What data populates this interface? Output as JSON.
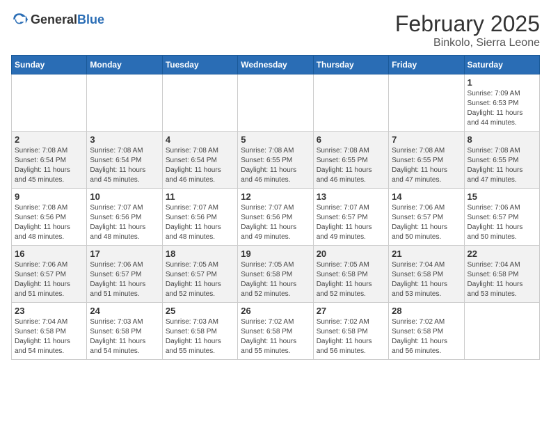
{
  "header": {
    "logo_general": "General",
    "logo_blue": "Blue",
    "month": "February 2025",
    "location": "Binkolo, Sierra Leone"
  },
  "days_of_week": [
    "Sunday",
    "Monday",
    "Tuesday",
    "Wednesday",
    "Thursday",
    "Friday",
    "Saturday"
  ],
  "weeks": [
    [
      {
        "day": "",
        "info": ""
      },
      {
        "day": "",
        "info": ""
      },
      {
        "day": "",
        "info": ""
      },
      {
        "day": "",
        "info": ""
      },
      {
        "day": "",
        "info": ""
      },
      {
        "day": "",
        "info": ""
      },
      {
        "day": "1",
        "info": "Sunrise: 7:09 AM\nSunset: 6:53 PM\nDaylight: 11 hours\nand 44 minutes."
      }
    ],
    [
      {
        "day": "2",
        "info": "Sunrise: 7:08 AM\nSunset: 6:54 PM\nDaylight: 11 hours\nand 45 minutes."
      },
      {
        "day": "3",
        "info": "Sunrise: 7:08 AM\nSunset: 6:54 PM\nDaylight: 11 hours\nand 45 minutes."
      },
      {
        "day": "4",
        "info": "Sunrise: 7:08 AM\nSunset: 6:54 PM\nDaylight: 11 hours\nand 46 minutes."
      },
      {
        "day": "5",
        "info": "Sunrise: 7:08 AM\nSunset: 6:55 PM\nDaylight: 11 hours\nand 46 minutes."
      },
      {
        "day": "6",
        "info": "Sunrise: 7:08 AM\nSunset: 6:55 PM\nDaylight: 11 hours\nand 46 minutes."
      },
      {
        "day": "7",
        "info": "Sunrise: 7:08 AM\nSunset: 6:55 PM\nDaylight: 11 hours\nand 47 minutes."
      },
      {
        "day": "8",
        "info": "Sunrise: 7:08 AM\nSunset: 6:55 PM\nDaylight: 11 hours\nand 47 minutes."
      }
    ],
    [
      {
        "day": "9",
        "info": "Sunrise: 7:08 AM\nSunset: 6:56 PM\nDaylight: 11 hours\nand 48 minutes."
      },
      {
        "day": "10",
        "info": "Sunrise: 7:07 AM\nSunset: 6:56 PM\nDaylight: 11 hours\nand 48 minutes."
      },
      {
        "day": "11",
        "info": "Sunrise: 7:07 AM\nSunset: 6:56 PM\nDaylight: 11 hours\nand 48 minutes."
      },
      {
        "day": "12",
        "info": "Sunrise: 7:07 AM\nSunset: 6:56 PM\nDaylight: 11 hours\nand 49 minutes."
      },
      {
        "day": "13",
        "info": "Sunrise: 7:07 AM\nSunset: 6:57 PM\nDaylight: 11 hours\nand 49 minutes."
      },
      {
        "day": "14",
        "info": "Sunrise: 7:06 AM\nSunset: 6:57 PM\nDaylight: 11 hours\nand 50 minutes."
      },
      {
        "day": "15",
        "info": "Sunrise: 7:06 AM\nSunset: 6:57 PM\nDaylight: 11 hours\nand 50 minutes."
      }
    ],
    [
      {
        "day": "16",
        "info": "Sunrise: 7:06 AM\nSunset: 6:57 PM\nDaylight: 11 hours\nand 51 minutes."
      },
      {
        "day": "17",
        "info": "Sunrise: 7:06 AM\nSunset: 6:57 PM\nDaylight: 11 hours\nand 51 minutes."
      },
      {
        "day": "18",
        "info": "Sunrise: 7:05 AM\nSunset: 6:57 PM\nDaylight: 11 hours\nand 52 minutes."
      },
      {
        "day": "19",
        "info": "Sunrise: 7:05 AM\nSunset: 6:58 PM\nDaylight: 11 hours\nand 52 minutes."
      },
      {
        "day": "20",
        "info": "Sunrise: 7:05 AM\nSunset: 6:58 PM\nDaylight: 11 hours\nand 52 minutes."
      },
      {
        "day": "21",
        "info": "Sunrise: 7:04 AM\nSunset: 6:58 PM\nDaylight: 11 hours\nand 53 minutes."
      },
      {
        "day": "22",
        "info": "Sunrise: 7:04 AM\nSunset: 6:58 PM\nDaylight: 11 hours\nand 53 minutes."
      }
    ],
    [
      {
        "day": "23",
        "info": "Sunrise: 7:04 AM\nSunset: 6:58 PM\nDaylight: 11 hours\nand 54 minutes."
      },
      {
        "day": "24",
        "info": "Sunrise: 7:03 AM\nSunset: 6:58 PM\nDaylight: 11 hours\nand 54 minutes."
      },
      {
        "day": "25",
        "info": "Sunrise: 7:03 AM\nSunset: 6:58 PM\nDaylight: 11 hours\nand 55 minutes."
      },
      {
        "day": "26",
        "info": "Sunrise: 7:02 AM\nSunset: 6:58 PM\nDaylight: 11 hours\nand 55 minutes."
      },
      {
        "day": "27",
        "info": "Sunrise: 7:02 AM\nSunset: 6:58 PM\nDaylight: 11 hours\nand 56 minutes."
      },
      {
        "day": "28",
        "info": "Sunrise: 7:02 AM\nSunset: 6:58 PM\nDaylight: 11 hours\nand 56 minutes."
      },
      {
        "day": "",
        "info": ""
      }
    ]
  ]
}
